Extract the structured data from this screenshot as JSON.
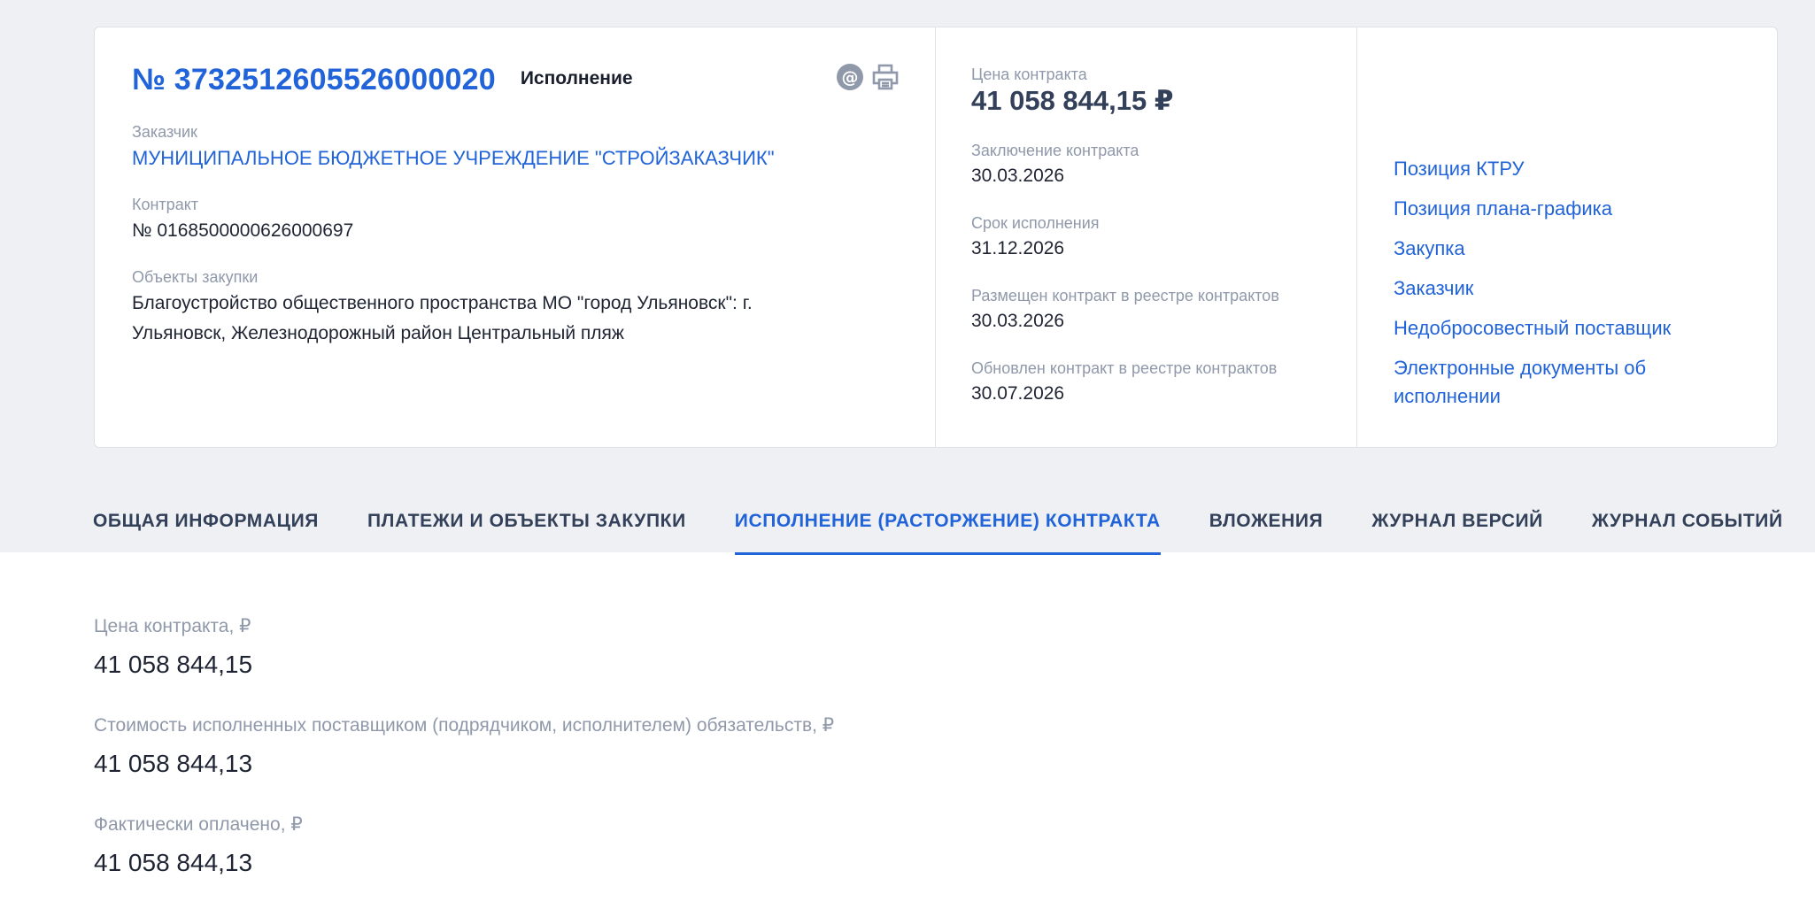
{
  "header": {
    "number": "№ 3732512605526000020",
    "status": "Исполнение",
    "icons": [
      "email-icon",
      "print-icon"
    ]
  },
  "customer": {
    "label": "Заказчик",
    "value": "МУНИЦИПАЛЬНОЕ БЮДЖЕТНОЕ УЧРЕЖДЕНИЕ \"СТРОЙЗАКАЗЧИК\""
  },
  "contract": {
    "label": "Контракт",
    "value": "№ 0168500000626000697"
  },
  "objects": {
    "label": "Объекты закупки",
    "value": "Благоустройство общественного пространства МО \"город Ульяновск\": г. Ульяновск, Железнодорожный район Центральный пляж"
  },
  "price": {
    "label": "Цена контракта",
    "value": "41 058 844,15 ₽"
  },
  "conclusion": {
    "label": "Заключение контракта",
    "value": "30.03.2026"
  },
  "term": {
    "label": "Срок исполнения",
    "value": "31.12.2026"
  },
  "registry_placed": {
    "label": "Размещен контракт в реестре контрактов",
    "value": "30.03.2026"
  },
  "registry_updated": {
    "label": "Обновлен контракт в реестре контрактов",
    "value": "30.07.2026"
  },
  "links": [
    "Позиция КТРУ",
    "Позиция плана-графика",
    "Закупка",
    "Заказчик",
    "Недобросовестный поставщик",
    "Электронные документы об исполнении"
  ],
  "tabs": [
    "ОБЩАЯ ИНФОРМАЦИЯ",
    "ПЛАТЕЖИ И ОБЪЕКТЫ ЗАКУПКИ",
    "ИСПОЛНЕНИЕ (РАСТОРЖЕНИЕ) КОНТРАКТА",
    "ВЛОЖЕНИЯ",
    "ЖУРНАЛ ВЕРСИЙ",
    "ЖУРНАЛ СОБЫТИЙ"
  ],
  "active_tab": "ИСПОЛНЕНИЕ (РАСТОРЖЕНИЕ) КОНТРАКТА",
  "execution": [
    {
      "label": "Цена контракта, ₽",
      "value": "41 058 844,15"
    },
    {
      "label": "Стоимость исполненных поставщиком (подрядчиком, исполнителем) обязательств, ₽",
      "value": "41 058 844,13"
    },
    {
      "label": "Фактически оплачено, ₽",
      "value": "41 058 844,13"
    }
  ],
  "colors": {
    "accent": "#2163d8",
    "background_band": "#eef0f3",
    "label": "#8f99aa",
    "text": "#1f2433",
    "heading": "#334059"
  }
}
